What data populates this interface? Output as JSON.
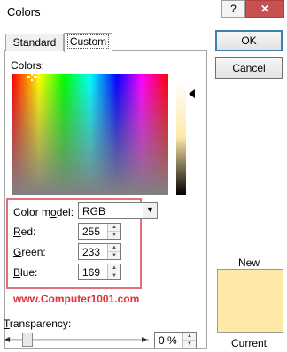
{
  "window": {
    "title": "Colors",
    "help_label": "?",
    "close_label": "✕"
  },
  "tabs": [
    {
      "label": "Standard",
      "selected": false
    },
    {
      "label": "Custom",
      "selected": true
    }
  ],
  "colors_label": "Colors:",
  "color_model": {
    "label_prefix": "Color m",
    "label_underline": "o",
    "label_suffix": "del:",
    "value": "RGB"
  },
  "red": {
    "label_underline": "R",
    "label_suffix": "ed:",
    "value": "255"
  },
  "green": {
    "label_underline": "G",
    "label_suffix": "reen:",
    "value": "233"
  },
  "blue": {
    "label_underline": "B",
    "label_suffix": "lue:",
    "value": "169"
  },
  "watermark": "www.Computer1001.com",
  "transparency": {
    "label_prefix": "",
    "label_underline": "T",
    "label_suffix": "ransparency:",
    "value": "0 %",
    "level": 0
  },
  "buttons": {
    "ok": "OK",
    "cancel": "Cancel"
  },
  "preview": {
    "new_label": "New",
    "current_label": "Current",
    "new_color": "#ffe9a9",
    "current_color": "#ffe9a9"
  },
  "colors": {
    "highlight_border": "#e0707a",
    "watermark": "#e0303a",
    "close_button": "#c75050"
  }
}
